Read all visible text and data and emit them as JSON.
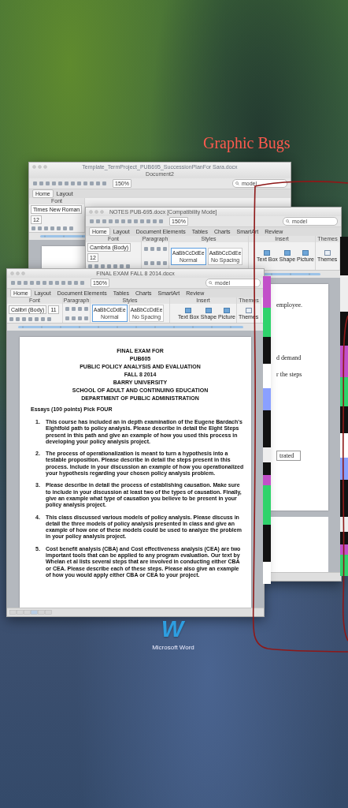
{
  "annotation": {
    "text": "Graphic Bugs"
  },
  "windows": [
    {
      "ghost_title": "Template_TermProject_PUB695_SuccessionPlanFor Sara.docx",
      "title": "Document2",
      "zoom": "150%",
      "search": "model",
      "tabs": [
        {
          "label": "Home",
          "selected": true
        },
        {
          "label": "Layout",
          "selected": false
        }
      ],
      "groups": [
        {
          "kind": "font",
          "label": "Font",
          "font_name": "Times New Roman",
          "font_size": "12"
        }
      ],
      "page": {
        "kind": "blank"
      }
    },
    {
      "title": "NOTES PUB-695.docx [Compatibility Mode]",
      "zoom": "150%",
      "search": "model",
      "tabs": [
        {
          "label": "Home",
          "selected": true
        },
        {
          "label": "Layout",
          "selected": false
        },
        {
          "label": "Document Elements",
          "selected": false
        },
        {
          "label": "Tables",
          "selected": false
        },
        {
          "label": "Charts",
          "selected": false
        },
        {
          "label": "SmartArt",
          "selected": false
        },
        {
          "label": "Review",
          "selected": false
        }
      ],
      "groups": [
        {
          "kind": "font",
          "label": "Font",
          "font_name": "Cambria (Body)",
          "font_size": "12"
        },
        {
          "kind": "paragraph",
          "label": "Paragraph"
        },
        {
          "kind": "styles",
          "label": "Styles",
          "items": [
            {
              "name": "Normal",
              "preview": "AaBbCcDdEe",
              "selected": true
            },
            {
              "name": "No Spacing",
              "preview": "AaBbCcDdEe",
              "selected": false
            }
          ]
        },
        {
          "kind": "insert",
          "label": "Insert",
          "items": [
            "Text Box",
            "Shape",
            "Picture"
          ]
        },
        {
          "kind": "themes",
          "label": "Themes",
          "button": "Themes"
        }
      ],
      "page": {
        "kind": "fragments",
        "lines": [
          {
            "kind": "line",
            "text": "employee."
          },
          {
            "kind": "line",
            "text": "d demand"
          },
          {
            "kind": "line",
            "text": "r the steps"
          },
          {
            "kind": "table_cell",
            "text": "trated"
          }
        ]
      }
    },
    {
      "title": "FINAL EXAM  FALL 8 2014.docx",
      "zoom": "150%",
      "search": "model",
      "tabs": [
        {
          "label": "Home",
          "selected": true
        },
        {
          "label": "Layout",
          "selected": false
        },
        {
          "label": "Document Elements",
          "selected": false
        },
        {
          "label": "Tables",
          "selected": false
        },
        {
          "label": "Charts",
          "selected": false
        },
        {
          "label": "SmartArt",
          "selected": false
        },
        {
          "label": "Review",
          "selected": false
        }
      ],
      "groups": [
        {
          "kind": "font",
          "label": "Font",
          "font_name": "Calibri (Body)",
          "font_size": "11"
        },
        {
          "kind": "paragraph",
          "label": "Paragraph"
        },
        {
          "kind": "styles",
          "label": "Styles",
          "items": [
            {
              "name": "Normal",
              "preview": "AaBbCcDdEe",
              "selected": true
            },
            {
              "name": "No Spacing",
              "preview": "AaBbCcDdEe",
              "selected": false
            }
          ]
        },
        {
          "kind": "insert",
          "label": "Insert",
          "items": [
            "Text Box",
            "Shape",
            "Picture"
          ]
        },
        {
          "kind": "themes",
          "label": "Themes",
          "button": "Themes"
        }
      ],
      "page": {
        "kind": "exam",
        "headings": [
          "FINAL EXAM FOR",
          "PUB605",
          "PUBLIC POLICY ANALYSIS AND EVALUATION",
          "FALL 8 2014",
          "BARRY UNIVERSITY",
          "SCHOOL OF ADULT AND CONTINUING EDUCATION",
          "DEPARTMENT OF PUBLIC ADMINISTRATION"
        ],
        "intro": "Essays (100 points) Pick FOUR",
        "questions": [
          {
            "number": "1.",
            "text": "This course has included an in depth examination of the Eugene Bardach's Eightfold path to policy analysis. Please describe in detail the Eight Steps present in this path and give an example of how you used this process in developing your policy analysis project."
          },
          {
            "number": "2.",
            "text": "The process of operationalization is meant to turn a hypothesis into a testable proposition. Please describe in detail the steps present in this process. Include in your discussion an example of how you operationalized your hypothesis regarding your chosen policy analysis problem."
          },
          {
            "number": "3.",
            "text": "Please describe in detail the process of establishing causation. Make sure to include in your discussion at least two of the types of causation. Finally, give an example what type of causation you believe to be present in your policy analysis project."
          },
          {
            "number": "4.",
            "text": "This class discussed various models of policy analysis. Please discuss in detail the three models of policy analysis presented in class and give an example of how one of these models could be used to analyze the problem in your policy analysis project."
          },
          {
            "number": "5.",
            "text": "Cost benefit analysis (CBA) and Cost effectiveness analysis (CEA) are two important tools that can be applied to any program evaluation. Our text by Whelan et al lists several steps that are involved in conducting either CBA or CEA. Please describe each of these steps. Please also give an example of how you would apply either CBA or CEA to your project."
          }
        ]
      }
    }
  ],
  "dock": {
    "letter": "W",
    "label": "Microsoft Word"
  }
}
